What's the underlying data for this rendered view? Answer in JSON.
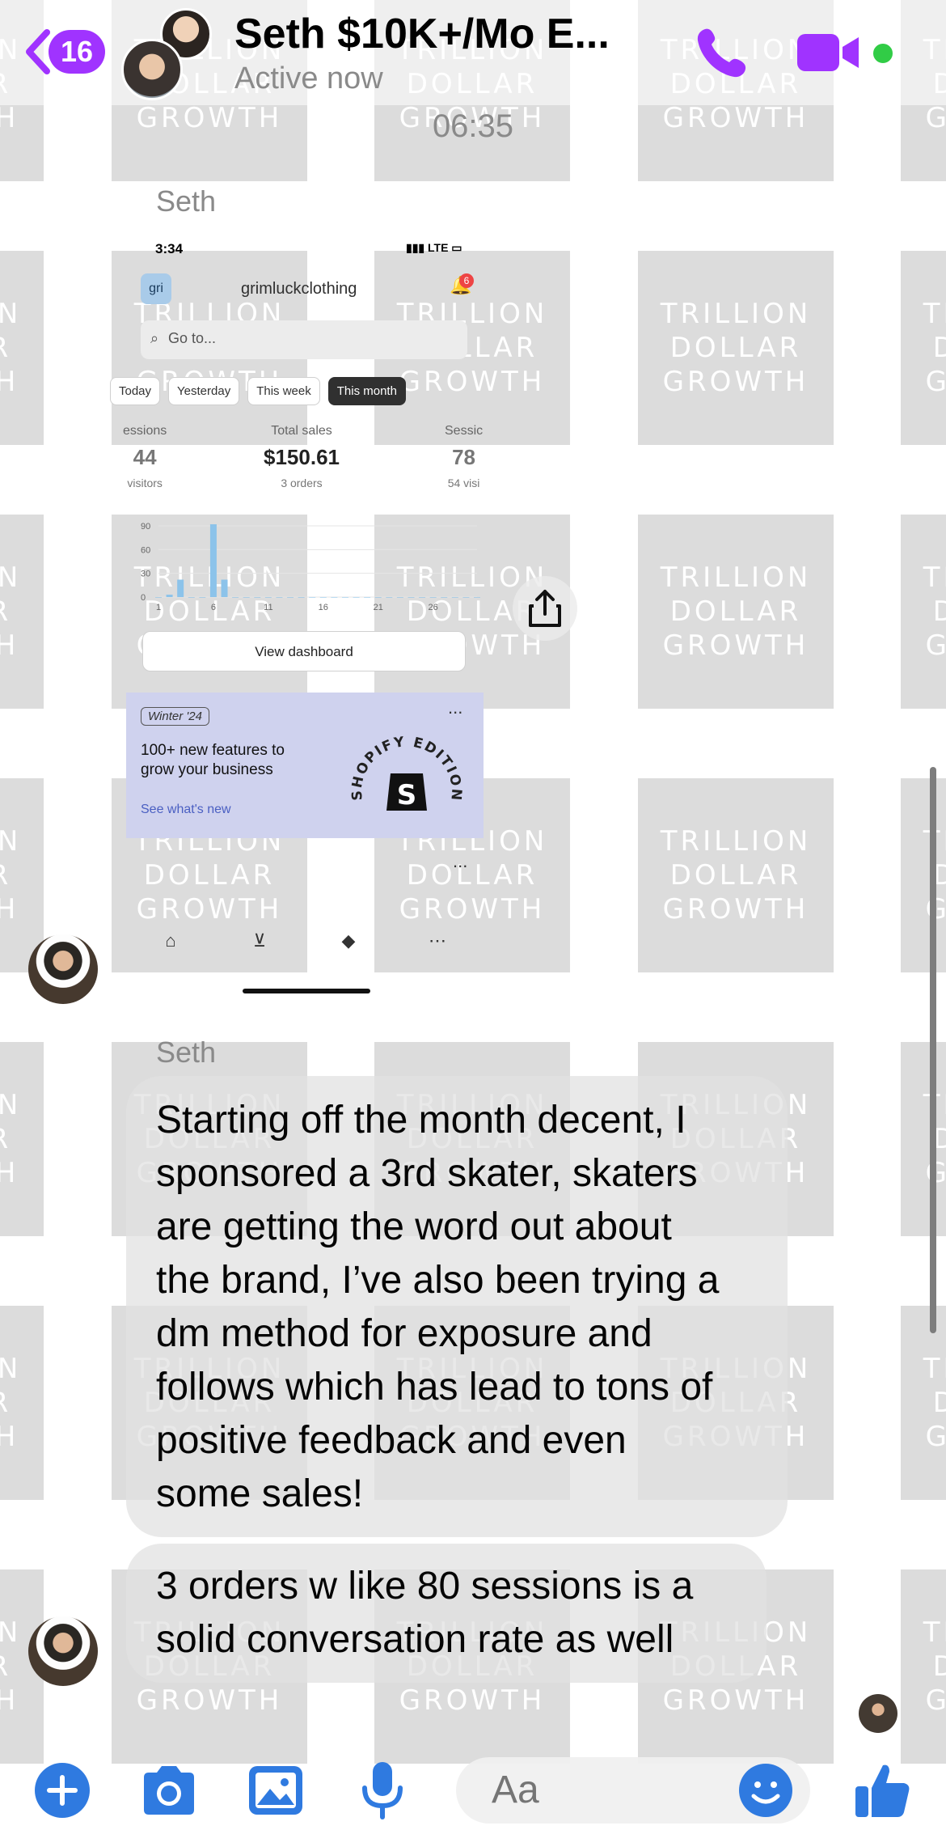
{
  "watermark": {
    "line1": "TRILLION",
    "line2": "DOLLAR",
    "line3": "GROWTH"
  },
  "header": {
    "unread_count": "16",
    "contact_name": "Seth $10K+/Mo E...",
    "status": "Active now",
    "accent_color": "#a033ff",
    "online_color": "#31cc46",
    "icons": [
      "back-chevron-icon",
      "phone-icon",
      "video-camera-icon"
    ]
  },
  "thread": {
    "timestamp": "06:35",
    "sender_label_1": "Seth",
    "sender_label_2": "Seth",
    "messages": [
      "Starting off the month decent, I\nsponsored a 3rd skater, skaters\nare getting the word out about\nthe brand, I’ve also been trying a\ndm method for exposure and\nfollows which has lead to tons of\npositive feedback and even\nsome sales!",
      "3 orders w like 80 sessions is a\nsolid conversation rate as well"
    ]
  },
  "shared_screenshot": {
    "status_time": "3:34",
    "network": "LTE",
    "store_logo_text": "gri",
    "store_name": "grimluckclothing",
    "notification_count": "6",
    "search_placeholder": "Go to...",
    "tabs": [
      "Today",
      "Yesterday",
      "This week",
      "This month"
    ],
    "active_tab": "This month",
    "metrics": [
      {
        "label": "essions",
        "value": "44",
        "sub": "visitors"
      },
      {
        "label": "Total sales",
        "value": "$150.61",
        "sub": "3 orders"
      },
      {
        "label": "Sessic",
        "value": "78",
        "sub": "54 visi"
      }
    ],
    "view_dashboard": "View dashboard",
    "promo_tag": "Winter '24",
    "promo_text": "100+ new features to grow your business",
    "promo_link": "See what's new",
    "seal_text": "SHOPIFY EDITIONS",
    "seal_letter": "S",
    "more": "...",
    "nav_icons": [
      "home-icon",
      "inbox-icon",
      "tag-icon",
      "more-icon"
    ]
  },
  "chart_data": {
    "type": "bar",
    "x": [
      1,
      2,
      3,
      4,
      5,
      6,
      7,
      8,
      9,
      10,
      11,
      12,
      13,
      14,
      15,
      16,
      17,
      18,
      19,
      20,
      21,
      22,
      23,
      24,
      25,
      26,
      27,
      28,
      29,
      30
    ],
    "values": [
      0,
      3,
      22,
      0,
      0,
      92,
      22,
      0,
      0,
      0,
      0,
      0,
      0,
      0,
      0,
      0,
      0,
      0,
      0,
      0,
      0,
      0,
      0,
      0,
      0,
      0,
      0,
      0,
      0,
      0
    ],
    "xticks": [
      "1",
      "6",
      "11",
      "16",
      "21",
      "26"
    ],
    "yticks": [
      "0",
      "30",
      "60",
      "90"
    ],
    "ylim": [
      0,
      90
    ],
    "grid": true,
    "bar_color": "#8cc3ea"
  },
  "composer": {
    "placeholder": "Aa",
    "icons": [
      "plus-icon",
      "camera-icon",
      "image-icon",
      "microphone-icon",
      "emoji-icon",
      "thumbs-up-icon"
    ],
    "icon_color": "#2f7ae0"
  }
}
